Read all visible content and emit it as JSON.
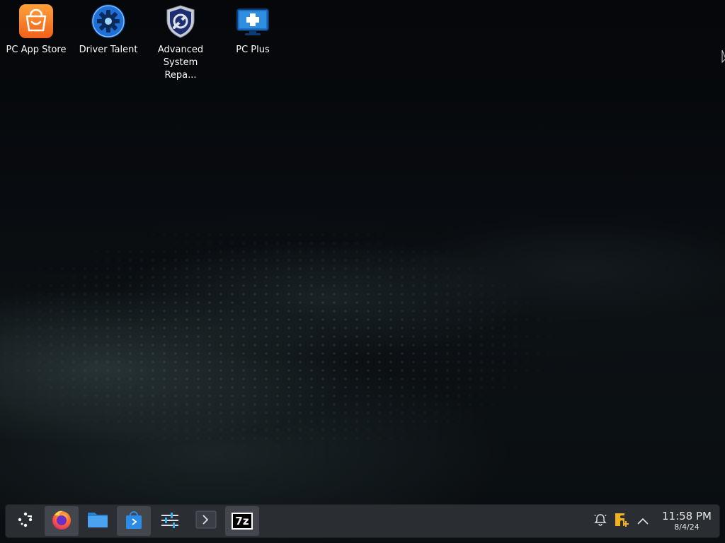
{
  "desktop": {
    "icons": [
      {
        "label": "PC App Store",
        "icon": "shopping-bag-icon"
      },
      {
        "label": "Driver Talent",
        "icon": "gear-icon"
      },
      {
        "label": "Advanced System Repa...",
        "icon": "shield-wrench-icon"
      },
      {
        "label": "PC Plus",
        "icon": "monitor-plus-icon"
      }
    ]
  },
  "taskbar": {
    "apps": [
      {
        "name": "Application Launcher",
        "icon": "launcher-icon"
      },
      {
        "name": "Firefox",
        "icon": "firefox-icon"
      },
      {
        "name": "Files",
        "icon": "folder-icon"
      },
      {
        "name": "Discover",
        "icon": "store-bag-icon"
      },
      {
        "name": "System Settings",
        "icon": "settings-sliders-icon"
      },
      {
        "name": "Terminal",
        "icon": "terminal-icon"
      },
      {
        "name": "7-Zip",
        "icon": "7zip-icon",
        "text": "7z"
      }
    ],
    "tray": {
      "notifications_icon": "bell-icon",
      "update_icon": "update-puzzle-icon",
      "expand_icon": "chevron-up-icon"
    },
    "clock": {
      "time": "11:58 PM",
      "date": "8/4/24"
    }
  },
  "colors": {
    "taskbar_bg": "#2a2d31",
    "app_store_orange": "#f77f1f",
    "driver_talent_blue": "#1f6fd6",
    "update_accent": "#f2b21d"
  }
}
